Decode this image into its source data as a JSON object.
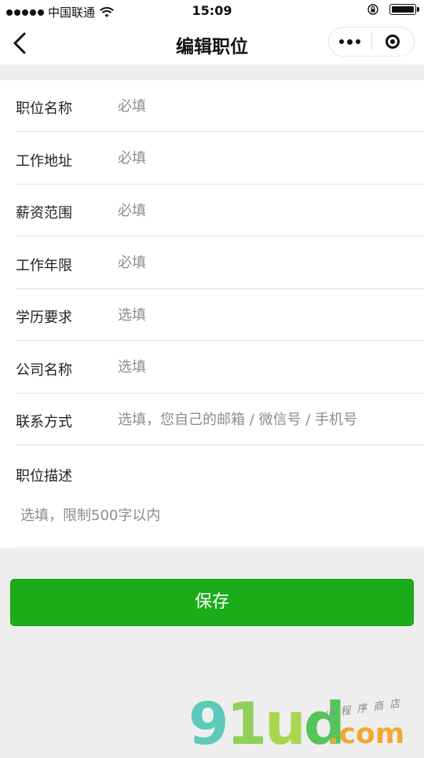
{
  "status_bar": {
    "carrier": "中国联通",
    "time": "15:09"
  },
  "nav": {
    "title": "编辑职位"
  },
  "form": {
    "fields": [
      {
        "label": "职位名称",
        "placeholder": "必填"
      },
      {
        "label": "工作地址",
        "placeholder": "必填"
      },
      {
        "label": "薪资范围",
        "placeholder": "必填"
      },
      {
        "label": "工作年限",
        "placeholder": "必填"
      },
      {
        "label": "学历要求",
        "placeholder": "选填"
      },
      {
        "label": "公司名称",
        "placeholder": "选填"
      },
      {
        "label": "联系方式",
        "placeholder": "选填，您自己的邮箱 / 微信号 / 手机号"
      }
    ],
    "description": {
      "label": "职位描述",
      "placeholder": "选填，限制500字以内"
    }
  },
  "actions": {
    "save_label": "保存"
  },
  "colors": {
    "primary_green": "#1aad19",
    "background": "#eeeeee"
  },
  "watermark": {
    "logo": "91ud",
    "suffix": ".com",
    "tagline": "小程序商店"
  }
}
